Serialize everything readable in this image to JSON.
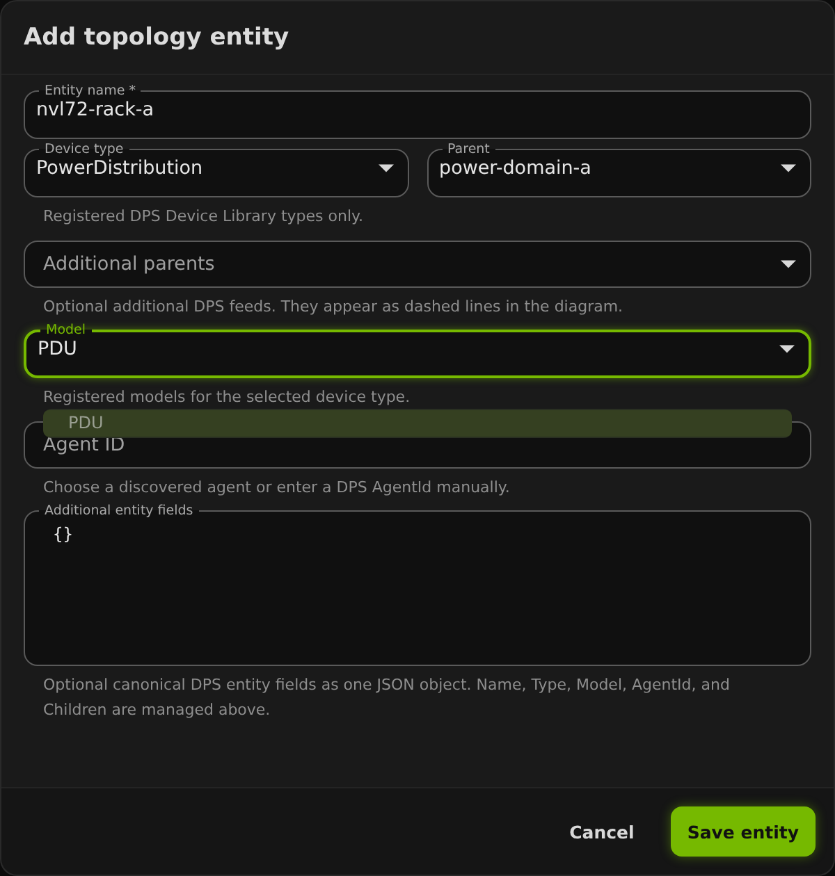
{
  "dialog": {
    "title": "Add topology entity"
  },
  "rows": [
    {
      "fields": [
        {
          "kind": "text",
          "label": "Entity name *",
          "value": "nvl72-rack-a",
          "focused": false
        }
      ]
    },
    {
      "fields": [
        {
          "kind": "select",
          "label": "Device type",
          "value": "PowerDistribution",
          "focused": false
        },
        {
          "kind": "select",
          "label": "Parent",
          "value": "power-domain-a",
          "focused": false
        }
      ],
      "helper": "Registered DPS Device Library types only."
    },
    {
      "fields": [
        {
          "kind": "select",
          "placeholder": "Additional parents",
          "focused": false
        }
      ],
      "helper": "Optional additional DPS feeds. They appear as dashed lines in the diagram."
    },
    {
      "fields": [
        {
          "kind": "select",
          "label": "Model",
          "value": "PDU",
          "focused": true,
          "menu": [
            {
              "label": "PDU",
              "selected": true
            }
          ]
        }
      ],
      "helper": "Registered models for the selected device type."
    },
    {
      "fields": [
        {
          "kind": "text",
          "placeholder": "Agent ID",
          "focused": false
        }
      ],
      "helper": "Choose a discovered agent or enter a DPS AgentId manually."
    },
    {
      "fields": [
        {
          "kind": "textarea",
          "label": "Additional entity fields",
          "value": "{}",
          "focused": false
        }
      ],
      "helper": "Optional canonical DPS entity fields as one JSON object. Name, Type, Model, AgentId, and Children are managed above."
    }
  ],
  "buttons": [
    {
      "kind": "text",
      "label": "Cancel"
    },
    {
      "kind": "primary",
      "label": "Save entity"
    }
  ]
}
